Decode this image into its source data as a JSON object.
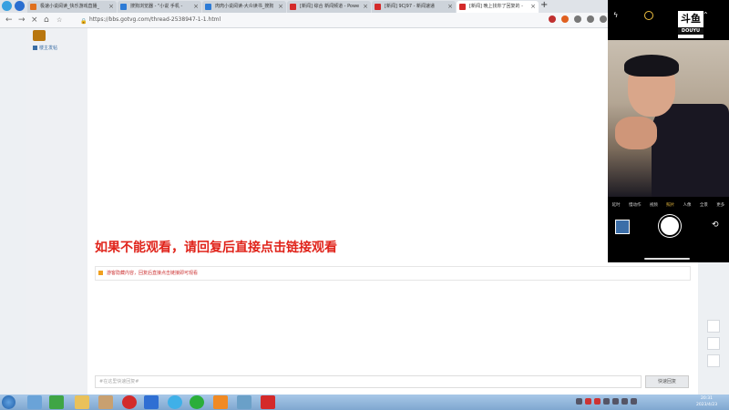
{
  "browser": {
    "tabs": [
      {
        "label": "极速小说阅读_快乐游戏直播_",
        "color": "#e0701e",
        "active": false
      },
      {
        "label": "搜狗浏览器 - \"小说 手机 - ",
        "color": "#2d7bd6",
        "active": false
      },
      {
        "label": "肉肉小说阅读-大众读书_搜狗",
        "color": "#2d7bd6",
        "active": false
      },
      {
        "label": "[新闻] 综合 新闻频道 - Powe",
        "color": "#d42a2a",
        "active": false
      },
      {
        "label": "[新闻] 9CJ97 - 新闻速递",
        "color": "#d42a2a",
        "active": false
      },
      {
        "label": "[新闻] 晚上找你了回复的 - ",
        "color": "#d42a2a",
        "active": true
      }
    ],
    "new_tab": "+",
    "tab_close": "×",
    "url": "https://bbs.gotvg.com/thread-2538947-1-1.html",
    "nav": {
      "back": "←",
      "forward": "→",
      "reload": "×",
      "home": "⌂"
    }
  },
  "sidebar": {
    "link_label": "楼主发帖"
  },
  "content": {
    "notice": "如果不能观看，请回复后直接点击链接观看",
    "tip_text": "游客隐藏内容，回复后直接点击链接即可观看",
    "reply_placeholder": "#在这里快速回复#",
    "reply_button": "快速回复"
  },
  "camera": {
    "flash_icon": "flash-off-icon",
    "logo_text": "斗鱼",
    "logo_sub": "DOUYU",
    "modes": [
      "延时",
      "慢动作",
      "视频",
      "照片",
      "人像",
      "全景",
      "更多"
    ],
    "selected_mode": "照片",
    "flip": "⟲"
  },
  "taskbar": {
    "clock_time": "20:31",
    "clock_date": "2023/4/23"
  },
  "colors": {
    "notice_red": "#e0241b",
    "link_blue": "#3b6ea5",
    "taskbar_blue": "#7fa7d0"
  }
}
